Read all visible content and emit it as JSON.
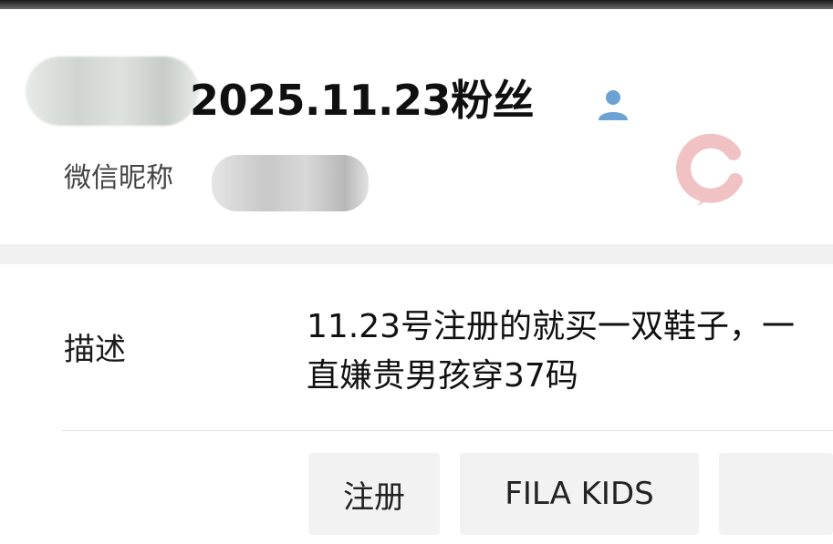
{
  "profile": {
    "title": "2025.11.23粉丝",
    "nickname_label": "微信昵称",
    "icon": "person-icon",
    "accent_color": "#6aa2d3"
  },
  "watermark": {
    "icon": "logo-watermark-icon",
    "color": "#f1c2c4"
  },
  "description": {
    "label": "描述",
    "text": "11.23号注册的就买一双鞋子，一直嫌贵男孩穿37码"
  },
  "tags": [
    {
      "label": "注册"
    },
    {
      "label": "FILA KIDS"
    }
  ]
}
